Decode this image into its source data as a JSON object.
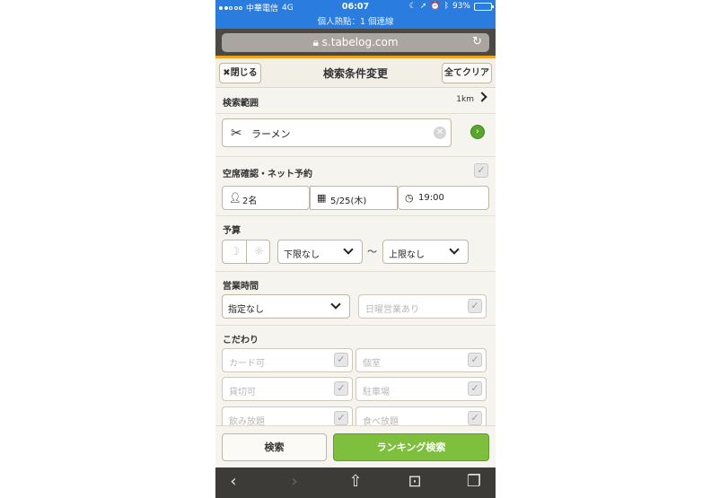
{
  "status": {
    "carrier": "中華電信",
    "network": "4G",
    "time": "06:07",
    "battery": "93%",
    "battery_level": 0.93,
    "hotspot": "個人熱點：1 個連線"
  },
  "browser": {
    "url": "s.tabelog.com"
  },
  "header": {
    "close_label": "閉じる",
    "title": "検索条件変更",
    "clear_label": "全てクリア"
  },
  "range": {
    "label": "検索範囲",
    "value": "1km"
  },
  "keyword": {
    "value": "ラーメン"
  },
  "reservation": {
    "label": "空席確認・ネット予約",
    "people": "2名",
    "date": "5/25(木)",
    "time": "19:00"
  },
  "budget": {
    "label": "予算",
    "lower": "下限なし",
    "separator": "～",
    "upper": "上限なし"
  },
  "hours": {
    "label": "営業時間",
    "selected": "指定なし",
    "sunday": "日曜営業あり"
  },
  "preferences": {
    "label": "こだわり",
    "items": [
      "カード可",
      "個室",
      "貸切可",
      "駐車場",
      "飲み放題",
      "食べ放題"
    ]
  },
  "actions": {
    "search_label": "検索",
    "ranking_label": "ランキング検索"
  }
}
